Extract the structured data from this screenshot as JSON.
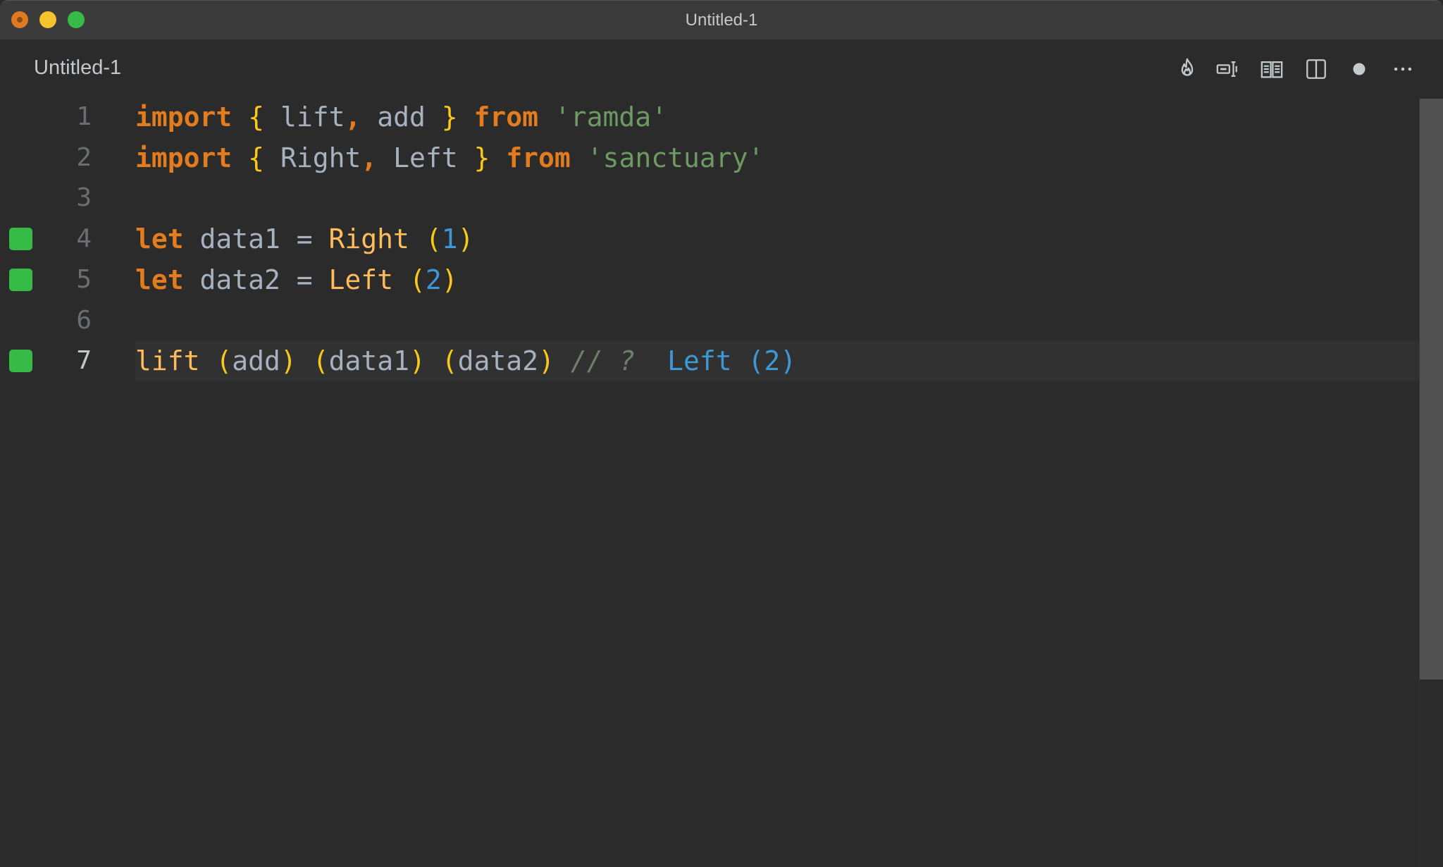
{
  "window": {
    "title": "Untitled-1",
    "traffic_lights": [
      "close",
      "minimize",
      "maximize"
    ]
  },
  "tab": {
    "label": "Untitled-1"
  },
  "toolbar": {
    "icons": [
      "flame-icon",
      "input-cursor-icon",
      "open-book-icon",
      "split-editor-icon",
      "unsaved-dot-icon",
      "more-actions-icon"
    ]
  },
  "editor": {
    "current_line": 7,
    "lines": [
      {
        "number": "1",
        "marker": false,
        "tokens": [
          {
            "t": "import",
            "c": "kw"
          },
          {
            "t": " ",
            "c": ""
          },
          {
            "t": "{",
            "c": "br"
          },
          {
            "t": " lift",
            "c": ""
          },
          {
            "t": ",",
            "c": "kw"
          },
          {
            "t": " add ",
            "c": ""
          },
          {
            "t": "}",
            "c": "br"
          },
          {
            "t": " ",
            "c": ""
          },
          {
            "t": "from",
            "c": "kw"
          },
          {
            "t": " ",
            "c": ""
          },
          {
            "t": "'ramda'",
            "c": "str"
          }
        ]
      },
      {
        "number": "2",
        "marker": false,
        "tokens": [
          {
            "t": "import",
            "c": "kw"
          },
          {
            "t": " ",
            "c": ""
          },
          {
            "t": "{",
            "c": "br"
          },
          {
            "t": " Right",
            "c": ""
          },
          {
            "t": ",",
            "c": "kw"
          },
          {
            "t": " Left ",
            "c": ""
          },
          {
            "t": "}",
            "c": "br"
          },
          {
            "t": " ",
            "c": ""
          },
          {
            "t": "from",
            "c": "kw"
          },
          {
            "t": " ",
            "c": ""
          },
          {
            "t": "'sanctuary'",
            "c": "str"
          }
        ]
      },
      {
        "number": "3",
        "marker": false,
        "tokens": []
      },
      {
        "number": "4",
        "marker": true,
        "tokens": [
          {
            "t": "let",
            "c": "kw"
          },
          {
            "t": " data1 = ",
            "c": ""
          },
          {
            "t": "Right",
            "c": "fn"
          },
          {
            "t": " ",
            "c": ""
          },
          {
            "t": "(",
            "c": "br"
          },
          {
            "t": "1",
            "c": "num"
          },
          {
            "t": ")",
            "c": "br"
          }
        ]
      },
      {
        "number": "5",
        "marker": true,
        "tokens": [
          {
            "t": "let",
            "c": "kw"
          },
          {
            "t": " data2 = ",
            "c": ""
          },
          {
            "t": "Left",
            "c": "fn"
          },
          {
            "t": " ",
            "c": ""
          },
          {
            "t": "(",
            "c": "br"
          },
          {
            "t": "2",
            "c": "num"
          },
          {
            "t": ")",
            "c": "br"
          }
        ]
      },
      {
        "number": "6",
        "marker": false,
        "tokens": []
      },
      {
        "number": "7",
        "marker": true,
        "tokens": [
          {
            "t": "lift",
            "c": "fn"
          },
          {
            "t": " ",
            "c": ""
          },
          {
            "t": "(",
            "c": "br"
          },
          {
            "t": "add",
            "c": ""
          },
          {
            "t": ")",
            "c": "br"
          },
          {
            "t": " ",
            "c": ""
          },
          {
            "t": "(",
            "c": "br"
          },
          {
            "t": "data1",
            "c": ""
          },
          {
            "t": ")",
            "c": "br"
          },
          {
            "t": " ",
            "c": ""
          },
          {
            "t": "(",
            "c": "br"
          },
          {
            "t": "data2",
            "c": ""
          },
          {
            "t": ")",
            "c": "br"
          },
          {
            "t": " ",
            "c": ""
          },
          {
            "t": "// ?",
            "c": "cmt"
          },
          {
            "t": "  ",
            "c": ""
          },
          {
            "t": "Left (2)",
            "c": "res"
          }
        ]
      }
    ]
  },
  "colors": {
    "keyword": "#e37b1f",
    "bracket": "#f9c81a",
    "string": "#6d9a63",
    "function": "#ffbc5a",
    "number": "#3f98d6",
    "comment": "#6e8069",
    "identifier": "#a6b2c0",
    "coverage_marker": "#36bb47",
    "background": "#2b2b2b"
  }
}
